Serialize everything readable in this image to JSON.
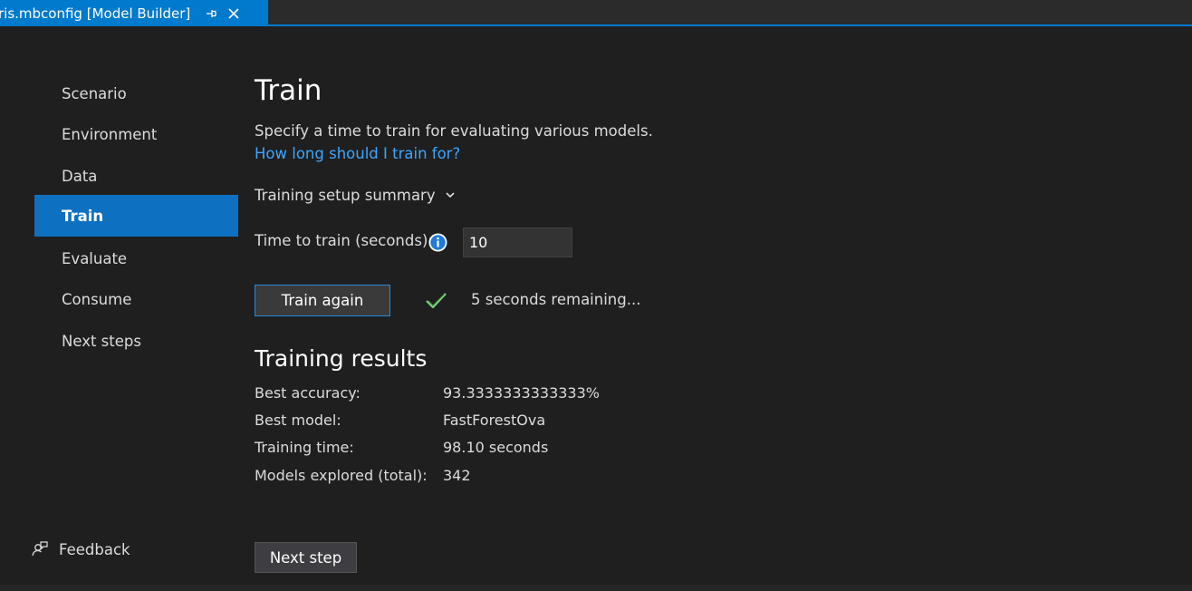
{
  "tab": {
    "title": "ris.mbconfig [Model Builder]",
    "pin_icon": "pin-icon",
    "close_icon": "close-icon"
  },
  "nav": {
    "items": [
      {
        "label": "Scenario",
        "active": false
      },
      {
        "label": "Environment",
        "active": false
      },
      {
        "label": "Data",
        "active": false
      },
      {
        "label": "Train",
        "active": true
      },
      {
        "label": "Evaluate",
        "active": false
      },
      {
        "label": "Consume",
        "active": false
      },
      {
        "label": "Next steps",
        "active": false
      }
    ],
    "feedback_label": "Feedback"
  },
  "main": {
    "title": "Train",
    "description": "Specify a time to train for evaluating various models.",
    "help_link": "How long should I train for?",
    "summary_label": "Training setup summary",
    "time_label": "Time to train (seconds):",
    "time_value": "10",
    "train_button": "Train again",
    "status_text": "5 seconds remaining...",
    "results_title": "Training results",
    "results": [
      {
        "label": "Best accuracy:",
        "value": "93.3333333333333%"
      },
      {
        "label": "Best model:",
        "value": "FastForestOva"
      },
      {
        "label": "Training time:",
        "value": "98.10 seconds"
      },
      {
        "label": "Models explored (total):",
        "value": "342"
      }
    ],
    "next_button": "Next step"
  },
  "colors": {
    "background": "#1f1f1f",
    "accent": "#007acc",
    "active_nav": "#0e70c0",
    "link": "#3ea6ff",
    "check": "#7fd37f"
  }
}
